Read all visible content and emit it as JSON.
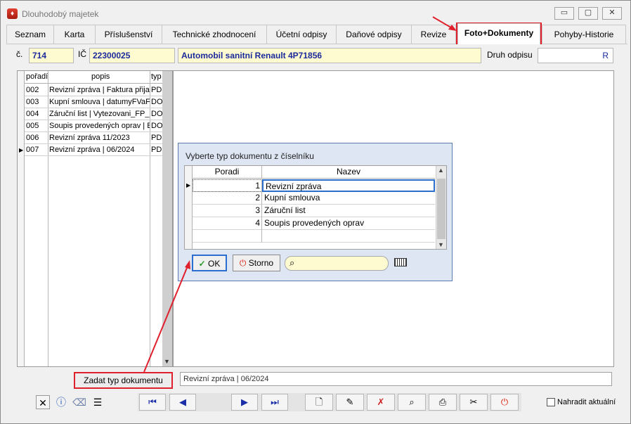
{
  "window": {
    "title": "Dlouhodobý majetek",
    "min_glyph": "▭",
    "max_glyph": "▢",
    "close_glyph": "✕"
  },
  "tabs": [
    "Seznam",
    "Karta",
    "Příslušenství",
    "Technické zhodnocení",
    "Účetní odpisy",
    "Daňové odpisy",
    "Revize",
    "Foto+Dokumenty",
    "Pohyby-Historie"
  ],
  "header": {
    "c_label": "č.",
    "c_value": "714",
    "ic_label": "IČ",
    "ic_value": "22300025",
    "name_value": "Automobil sanitní Renault 4P71856",
    "druh_label": "Druh odpisu",
    "druh_value": "R"
  },
  "doc_grid": {
    "columns": [
      "pořadí",
      "popis",
      "typ"
    ],
    "rows": [
      [
        "002",
        "Revizní zpráva | Faktura přijat",
        "PD"
      ],
      [
        "003",
        "Kupní smlouva | datumyFVaFP",
        "DO"
      ],
      [
        "004",
        "Záruční list | Vytezovani_FP_",
        "DO"
      ],
      [
        "005",
        "Soupis provedených oprav | E",
        "DO"
      ],
      [
        "006",
        "Revizní zpráva 11/2023",
        "PD"
      ],
      [
        "007",
        "Revizní zpráva | 06/2024",
        "PD"
      ]
    ]
  },
  "dialog": {
    "title": "Vyberte typ dokumentu z číselníku",
    "columns": [
      "Poradi",
      "Nazev"
    ],
    "rows": [
      [
        "1",
        "Revizní zpráva"
      ],
      [
        "2",
        "Kupní smlouva"
      ],
      [
        "3",
        "Záruční list"
      ],
      [
        "4",
        "Soupis provedených oprav"
      ]
    ],
    "ok_label": "OK",
    "storno_label": "Storno",
    "search_value": ""
  },
  "status_text": "Revizní zpráva | 06/2024",
  "zadat_button": "Zadat typ dokumentu",
  "nahradit_label": "Nahradit aktuální",
  "colors": {
    "highlight": "#e0202c",
    "field_bg": "#fffbd0",
    "field_text": "#1a2a9c",
    "nav_blue": "#1a2ea8"
  }
}
